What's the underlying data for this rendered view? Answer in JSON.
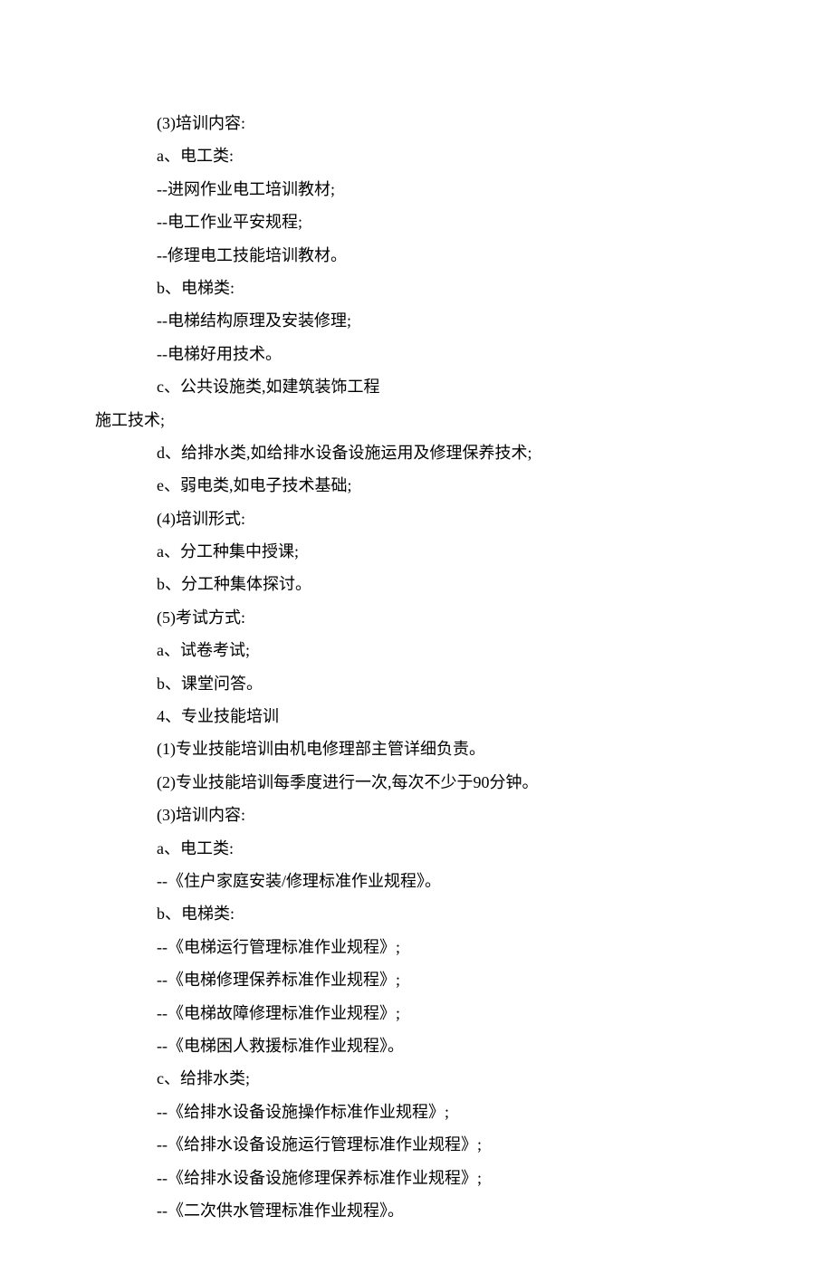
{
  "lines": [
    {
      "text": "(3)培训内容:",
      "indent": true
    },
    {
      "text": "a、电工类:",
      "indent": true
    },
    {
      "text": "--进网作业电工培训教材;",
      "indent": true
    },
    {
      "text": "--电工作业平安规程;",
      "indent": true
    },
    {
      "text": "--修理电工技能培训教材。",
      "indent": true
    },
    {
      "text": "b、电梯类:",
      "indent": true
    },
    {
      "text": "--电梯结构原理及安装修理;",
      "indent": true
    },
    {
      "text": "--电梯好用技术。",
      "indent": true
    },
    {
      "text": "c、公共设施类,如建筑装饰工程",
      "indent": true
    },
    {
      "text": "施工技术;",
      "indent": false
    },
    {
      "text": "d、给排水类,如给排水设备设施运用及修理保养技术;",
      "indent": true
    },
    {
      "text": "e、弱电类,如电子技术基础;",
      "indent": true
    },
    {
      "text": "(4)培训形式:",
      "indent": true
    },
    {
      "text": "a、分工种集中授课;",
      "indent": true
    },
    {
      "text": "b、分工种集体探讨。",
      "indent": true
    },
    {
      "text": "(5)考试方式:",
      "indent": true
    },
    {
      "text": "a、试卷考试;",
      "indent": true
    },
    {
      "text": "b、课堂问答。",
      "indent": true
    },
    {
      "text": "4、专业技能培训",
      "indent": true
    },
    {
      "text": "(1)专业技能培训由机电修理部主管详细负责。",
      "indent": true
    },
    {
      "text": "(2)专业技能培训每季度进行一次,每次不少于90分钟。",
      "indent": true
    },
    {
      "text": "(3)培训内容:",
      "indent": true
    },
    {
      "text": "a、电工类:",
      "indent": true
    },
    {
      "text": "--《住户家庭安装/修理标准作业规程》。",
      "indent": true
    },
    {
      "text": "b、电梯类:",
      "indent": true
    },
    {
      "text": "--《电梯运行管理标准作业规程》;",
      "indent": true
    },
    {
      "text": "--《电梯修理保养标准作业规程》;",
      "indent": true
    },
    {
      "text": "--《电梯故障修理标准作业规程》;",
      "indent": true
    },
    {
      "text": "--《电梯困人救援标准作业规程》。",
      "indent": true
    },
    {
      "text": "c、给排水类;",
      "indent": true
    },
    {
      "text": "--《给排水设备设施操作标准作业规程》;",
      "indent": true
    },
    {
      "text": "--《给排水设备设施运行管理标准作业规程》;",
      "indent": true
    },
    {
      "text": "--《给排水设备设施修理保养标准作业规程》;",
      "indent": true
    },
    {
      "text": "--《二次供水管理标准作业规程》。",
      "indent": true
    }
  ]
}
